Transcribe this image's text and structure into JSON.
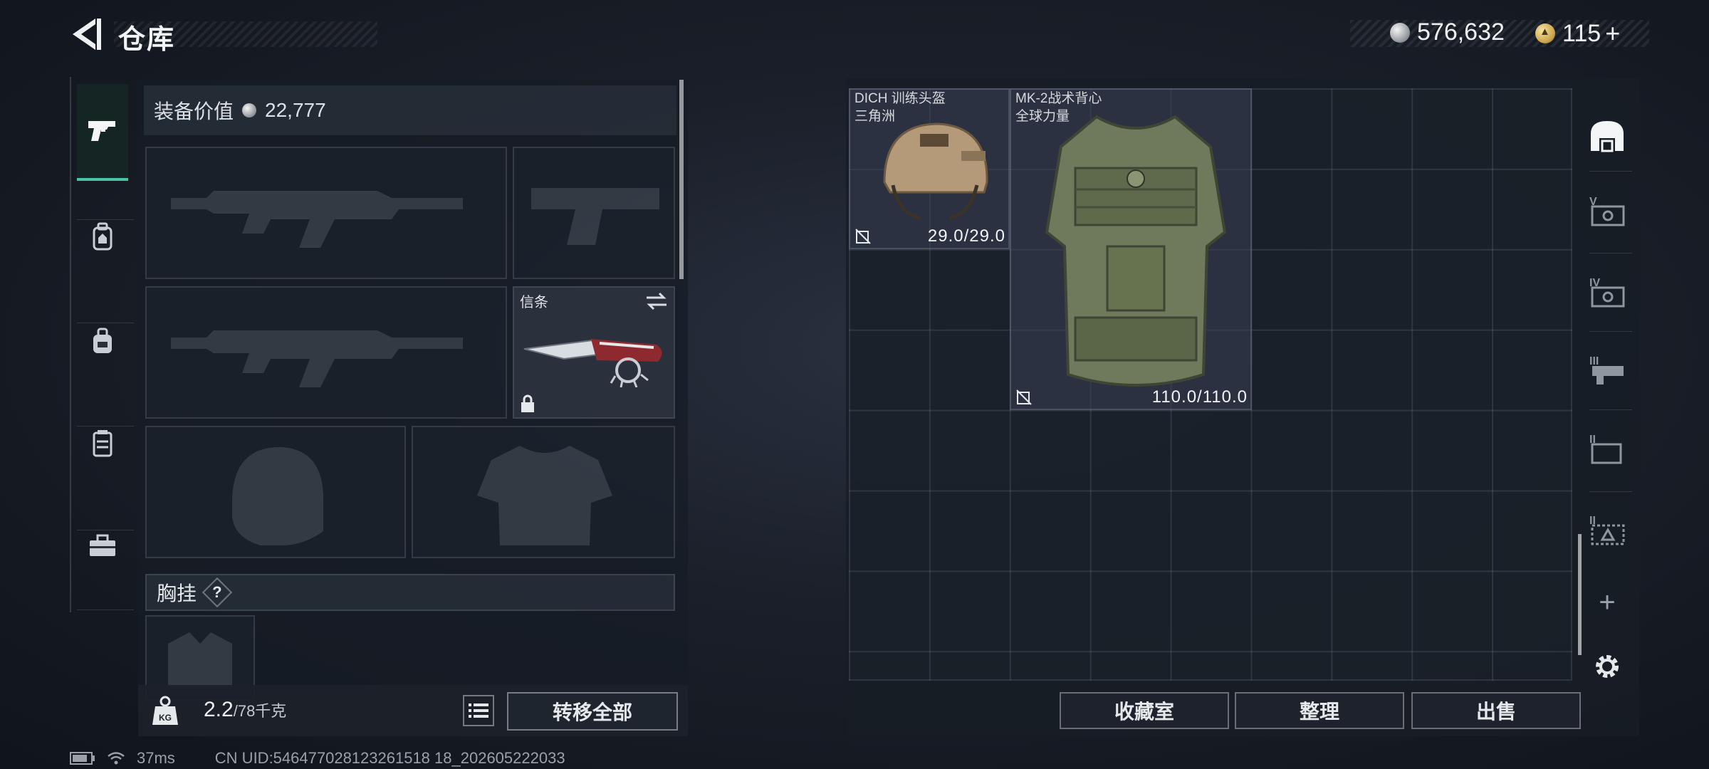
{
  "header": {
    "title": "仓库",
    "silver_amount": "576,632",
    "gold_amount": "115",
    "gold_plus": "+"
  },
  "left_nav": {
    "items": [
      {
        "icon": "pistol-icon",
        "active": true
      },
      {
        "icon": "backpack-icon",
        "active": false
      },
      {
        "icon": "bag-icon",
        "active": false
      },
      {
        "icon": "vest-icon",
        "active": false
      },
      {
        "icon": "toolbox-icon",
        "active": false
      }
    ]
  },
  "loadout": {
    "value_label": "装备价值",
    "value_amount": "22,777",
    "melee_label": "信条",
    "chest_rig_label": "胸挂",
    "chest_rig_help": "?"
  },
  "weight": {
    "current": "2.2",
    "capacity": "/78千克"
  },
  "transfer_all_label": "转移全部",
  "stash_items": [
    {
      "name": "DICH 训练头盔",
      "sub": "三角洲",
      "durability": "29.0/29.0"
    },
    {
      "name": "MK-2战术背心",
      "sub": "全球力量",
      "durability": "110.0/110.0"
    }
  ],
  "stash_buttons": {
    "collection": "收藏室",
    "organize": "整理",
    "sell": "出售"
  },
  "right_tabs": [
    "home-tab-icon",
    "tier-v-case-icon",
    "tier-iv-case-icon",
    "tier-iii-case-icon",
    "tier-ii-case-icon",
    "tier-i-case-icon"
  ],
  "right_tabs_add": "+",
  "status": {
    "ping": "37ms",
    "uid": "CN UID:546477028123261518 18_202605222033"
  },
  "colors": {
    "accent": "#49c3a3",
    "panel": "#161c25"
  }
}
